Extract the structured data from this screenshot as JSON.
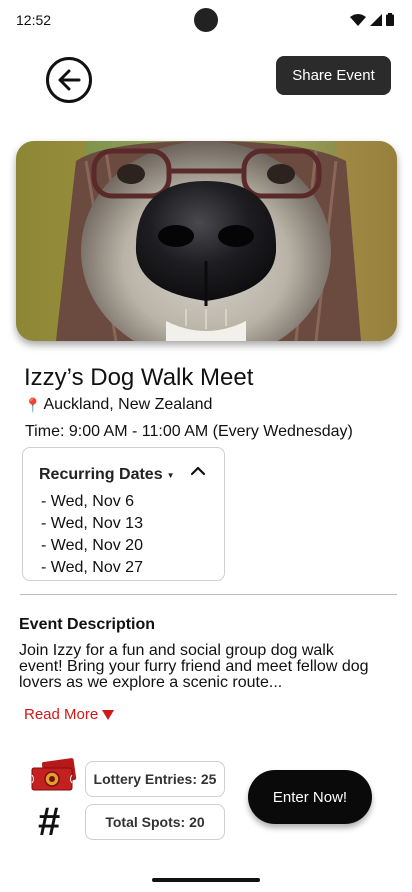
{
  "status_bar": {
    "time": "12:52"
  },
  "header": {
    "share_label": "Share Event"
  },
  "event": {
    "title": "Izzy’s Dog Walk Meet",
    "location": "Auckland, New Zealand",
    "time": "Time: 9:00 AM - 11:00 AM (Every Wednesday)"
  },
  "recurring": {
    "label": "Recurring Dates",
    "dates": [
      "- Wed, Nov 6",
      "- Wed, Nov 13",
      "- Wed, Nov 20",
      "- Wed, Nov 27"
    ]
  },
  "description": {
    "heading": "Event Description",
    "text": "Join Izzy for a fun and social group dog walk event! Bring your furry friend and meet fellow dog lovers as we explore a scenic route...",
    "read_more": "Read More"
  },
  "stats": {
    "lottery_entries": "Lottery Entries: 25",
    "total_spots": "Total Spots: 20"
  },
  "cta": {
    "enter_label": "Enter  Now!"
  },
  "colors": {
    "accent_red": "#d01818",
    "dark_button": "#2b2b2b",
    "cta_black": "#0a0a0a"
  }
}
